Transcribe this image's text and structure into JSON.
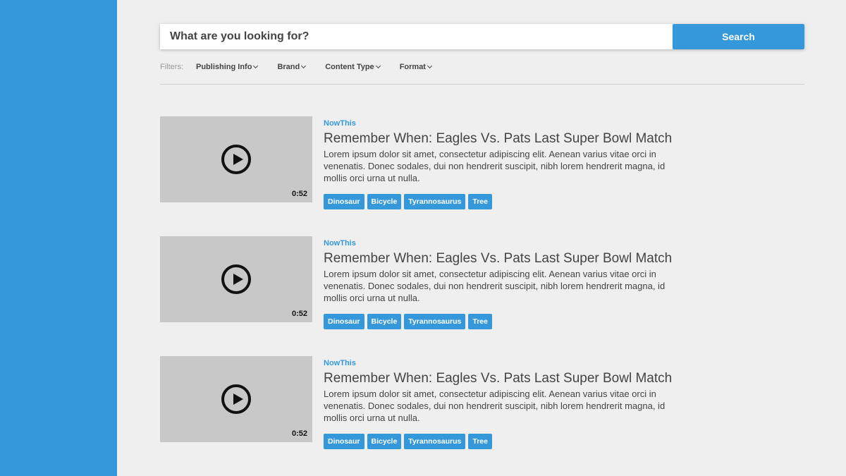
{
  "search": {
    "placeholder": "What are you looking for?",
    "button_label": "Search"
  },
  "filters": {
    "label": "Filters:",
    "items": [
      "Publishing Info",
      "Brand",
      "Content Type",
      "Format"
    ]
  },
  "colors": {
    "accent": "#3498db",
    "background": "#efefef",
    "thumbnail": "#c8c8c8"
  },
  "results": [
    {
      "source": "NowThis",
      "title": "Remember When: Eagles Vs. Pats Last Super Bowl Match",
      "description": "Lorem ipsum dolor sit amet, consectetur adipiscing elit. Aenean varius vitae orci in venenatis. Donec sodales, dui non hendrerit suscipit, nibh lorem hendrerit magna, id mollis orci urna ut nulla.",
      "duration": "0:52",
      "tags": [
        "Dinosaur",
        "Bicycle",
        "Tyrannosaurus",
        "Tree"
      ]
    },
    {
      "source": "NowThis",
      "title": "Remember When: Eagles Vs. Pats Last Super Bowl Match",
      "description": "Lorem ipsum dolor sit amet, consectetur adipiscing elit. Aenean varius vitae orci in venenatis. Donec sodales, dui non hendrerit suscipit, nibh lorem hendrerit magna, id mollis orci urna ut nulla.",
      "duration": "0:52",
      "tags": [
        "Dinosaur",
        "Bicycle",
        "Tyrannosaurus",
        "Tree"
      ]
    },
    {
      "source": "NowThis",
      "title": "Remember When: Eagles Vs. Pats Last Super Bowl Match",
      "description": "Lorem ipsum dolor sit amet, consectetur adipiscing elit. Aenean varius vitae orci in venenatis. Donec sodales, dui non hendrerit suscipit, nibh lorem hendrerit magna, id mollis orci urna ut nulla.",
      "duration": "0:52",
      "tags": [
        "Dinosaur",
        "Bicycle",
        "Tyrannosaurus",
        "Tree"
      ]
    }
  ]
}
